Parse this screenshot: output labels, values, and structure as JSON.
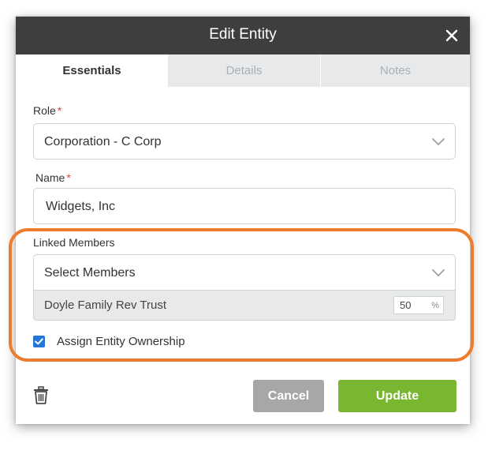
{
  "dialog": {
    "title": "Edit Entity",
    "close_icon": "close-icon"
  },
  "tabs": [
    {
      "label": "Essentials",
      "active": true
    },
    {
      "label": "Details",
      "active": false
    },
    {
      "label": "Notes",
      "active": false
    }
  ],
  "role": {
    "label": "Role",
    "required_mark": "*",
    "value": "Corporation - C Corp"
  },
  "name": {
    "label": "Name",
    "required_mark": "*",
    "value": "Widgets, Inc"
  },
  "linked_members": {
    "label": "Linked Members",
    "placeholder": "Select Members",
    "members": [
      {
        "name": "Doyle Family Rev Trust",
        "percent": "50",
        "percent_symbol": "%"
      }
    ]
  },
  "assign_ownership": {
    "label": "Assign Entity Ownership",
    "checked": true
  },
  "buttons": {
    "cancel": "Cancel",
    "update": "Update",
    "delete_icon": "trash-icon"
  },
  "colors": {
    "header_bg": "#3d3f3e",
    "highlight_ring": "#ec7d2f",
    "update_button": "#7ab730",
    "cancel_button": "#a5a8a7",
    "checkbox": "#2376d8",
    "required_mark": "#e03b3b"
  }
}
